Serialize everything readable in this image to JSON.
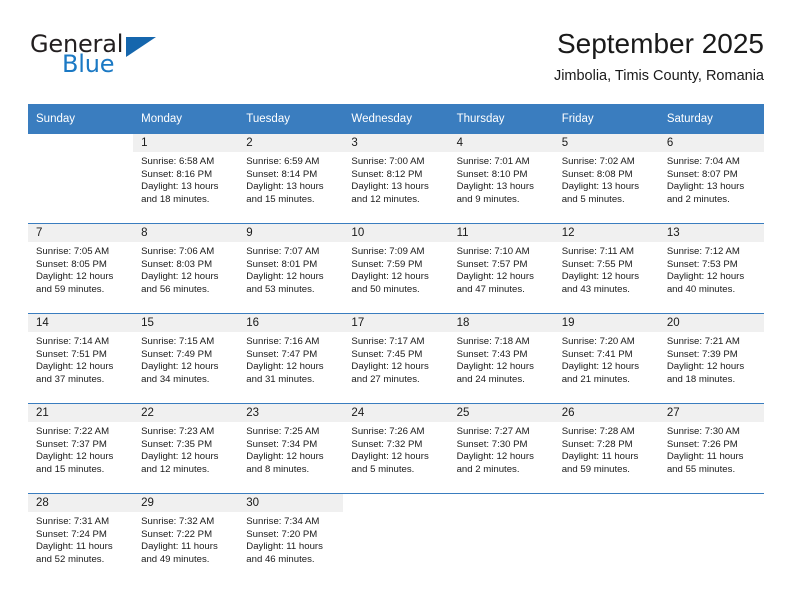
{
  "brand": {
    "name_part1": "General",
    "name_part2": "Blue",
    "accent_color": "#1b79c4",
    "triangle_color": "#1566ad",
    "logo_icon": "triangle-logo-icon"
  },
  "header": {
    "month_title": "September 2025",
    "location": "Jimbolia, Timis County, Romania"
  },
  "calendar": {
    "header_bg": "#3a7dbf",
    "daynum_band_bg": "#f0f0f0",
    "weekday_headers": [
      "Sunday",
      "Monday",
      "Tuesday",
      "Wednesday",
      "Thursday",
      "Friday",
      "Saturday"
    ],
    "weeks": [
      [
        {
          "day": "",
          "sunrise": "",
          "sunset": "",
          "daylight_line1": "",
          "daylight_line2": "",
          "blank": true
        },
        {
          "day": "1",
          "sunrise": "Sunrise: 6:58 AM",
          "sunset": "Sunset: 8:16 PM",
          "daylight_line1": "Daylight: 13 hours",
          "daylight_line2": "and 18 minutes."
        },
        {
          "day": "2",
          "sunrise": "Sunrise: 6:59 AM",
          "sunset": "Sunset: 8:14 PM",
          "daylight_line1": "Daylight: 13 hours",
          "daylight_line2": "and 15 minutes."
        },
        {
          "day": "3",
          "sunrise": "Sunrise: 7:00 AM",
          "sunset": "Sunset: 8:12 PM",
          "daylight_line1": "Daylight: 13 hours",
          "daylight_line2": "and 12 minutes."
        },
        {
          "day": "4",
          "sunrise": "Sunrise: 7:01 AM",
          "sunset": "Sunset: 8:10 PM",
          "daylight_line1": "Daylight: 13 hours",
          "daylight_line2": "and 9 minutes."
        },
        {
          "day": "5",
          "sunrise": "Sunrise: 7:02 AM",
          "sunset": "Sunset: 8:08 PM",
          "daylight_line1": "Daylight: 13 hours",
          "daylight_line2": "and 5 minutes."
        },
        {
          "day": "6",
          "sunrise": "Sunrise: 7:04 AM",
          "sunset": "Sunset: 8:07 PM",
          "daylight_line1": "Daylight: 13 hours",
          "daylight_line2": "and 2 minutes."
        }
      ],
      [
        {
          "day": "7",
          "sunrise": "Sunrise: 7:05 AM",
          "sunset": "Sunset: 8:05 PM",
          "daylight_line1": "Daylight: 12 hours",
          "daylight_line2": "and 59 minutes."
        },
        {
          "day": "8",
          "sunrise": "Sunrise: 7:06 AM",
          "sunset": "Sunset: 8:03 PM",
          "daylight_line1": "Daylight: 12 hours",
          "daylight_line2": "and 56 minutes."
        },
        {
          "day": "9",
          "sunrise": "Sunrise: 7:07 AM",
          "sunset": "Sunset: 8:01 PM",
          "daylight_line1": "Daylight: 12 hours",
          "daylight_line2": "and 53 minutes."
        },
        {
          "day": "10",
          "sunrise": "Sunrise: 7:09 AM",
          "sunset": "Sunset: 7:59 PM",
          "daylight_line1": "Daylight: 12 hours",
          "daylight_line2": "and 50 minutes."
        },
        {
          "day": "11",
          "sunrise": "Sunrise: 7:10 AM",
          "sunset": "Sunset: 7:57 PM",
          "daylight_line1": "Daylight: 12 hours",
          "daylight_line2": "and 47 minutes."
        },
        {
          "day": "12",
          "sunrise": "Sunrise: 7:11 AM",
          "sunset": "Sunset: 7:55 PM",
          "daylight_line1": "Daylight: 12 hours",
          "daylight_line2": "and 43 minutes."
        },
        {
          "day": "13",
          "sunrise": "Sunrise: 7:12 AM",
          "sunset": "Sunset: 7:53 PM",
          "daylight_line1": "Daylight: 12 hours",
          "daylight_line2": "and 40 minutes."
        }
      ],
      [
        {
          "day": "14",
          "sunrise": "Sunrise: 7:14 AM",
          "sunset": "Sunset: 7:51 PM",
          "daylight_line1": "Daylight: 12 hours",
          "daylight_line2": "and 37 minutes."
        },
        {
          "day": "15",
          "sunrise": "Sunrise: 7:15 AM",
          "sunset": "Sunset: 7:49 PM",
          "daylight_line1": "Daylight: 12 hours",
          "daylight_line2": "and 34 minutes."
        },
        {
          "day": "16",
          "sunrise": "Sunrise: 7:16 AM",
          "sunset": "Sunset: 7:47 PM",
          "daylight_line1": "Daylight: 12 hours",
          "daylight_line2": "and 31 minutes."
        },
        {
          "day": "17",
          "sunrise": "Sunrise: 7:17 AM",
          "sunset": "Sunset: 7:45 PM",
          "daylight_line1": "Daylight: 12 hours",
          "daylight_line2": "and 27 minutes."
        },
        {
          "day": "18",
          "sunrise": "Sunrise: 7:18 AM",
          "sunset": "Sunset: 7:43 PM",
          "daylight_line1": "Daylight: 12 hours",
          "daylight_line2": "and 24 minutes."
        },
        {
          "day": "19",
          "sunrise": "Sunrise: 7:20 AM",
          "sunset": "Sunset: 7:41 PM",
          "daylight_line1": "Daylight: 12 hours",
          "daylight_line2": "and 21 minutes."
        },
        {
          "day": "20",
          "sunrise": "Sunrise: 7:21 AM",
          "sunset": "Sunset: 7:39 PM",
          "daylight_line1": "Daylight: 12 hours",
          "daylight_line2": "and 18 minutes."
        }
      ],
      [
        {
          "day": "21",
          "sunrise": "Sunrise: 7:22 AM",
          "sunset": "Sunset: 7:37 PM",
          "daylight_line1": "Daylight: 12 hours",
          "daylight_line2": "and 15 minutes."
        },
        {
          "day": "22",
          "sunrise": "Sunrise: 7:23 AM",
          "sunset": "Sunset: 7:35 PM",
          "daylight_line1": "Daylight: 12 hours",
          "daylight_line2": "and 12 minutes."
        },
        {
          "day": "23",
          "sunrise": "Sunrise: 7:25 AM",
          "sunset": "Sunset: 7:34 PM",
          "daylight_line1": "Daylight: 12 hours",
          "daylight_line2": "and 8 minutes."
        },
        {
          "day": "24",
          "sunrise": "Sunrise: 7:26 AM",
          "sunset": "Sunset: 7:32 PM",
          "daylight_line1": "Daylight: 12 hours",
          "daylight_line2": "and 5 minutes."
        },
        {
          "day": "25",
          "sunrise": "Sunrise: 7:27 AM",
          "sunset": "Sunset: 7:30 PM",
          "daylight_line1": "Daylight: 12 hours",
          "daylight_line2": "and 2 minutes."
        },
        {
          "day": "26",
          "sunrise": "Sunrise: 7:28 AM",
          "sunset": "Sunset: 7:28 PM",
          "daylight_line1": "Daylight: 11 hours",
          "daylight_line2": "and 59 minutes."
        },
        {
          "day": "27",
          "sunrise": "Sunrise: 7:30 AM",
          "sunset": "Sunset: 7:26 PM",
          "daylight_line1": "Daylight: 11 hours",
          "daylight_line2": "and 55 minutes."
        }
      ],
      [
        {
          "day": "28",
          "sunrise": "Sunrise: 7:31 AM",
          "sunset": "Sunset: 7:24 PM",
          "daylight_line1": "Daylight: 11 hours",
          "daylight_line2": "and 52 minutes."
        },
        {
          "day": "29",
          "sunrise": "Sunrise: 7:32 AM",
          "sunset": "Sunset: 7:22 PM",
          "daylight_line1": "Daylight: 11 hours",
          "daylight_line2": "and 49 minutes."
        },
        {
          "day": "30",
          "sunrise": "Sunrise: 7:34 AM",
          "sunset": "Sunset: 7:20 PM",
          "daylight_line1": "Daylight: 11 hours",
          "daylight_line2": "and 46 minutes."
        },
        {
          "day": "",
          "sunrise": "",
          "sunset": "",
          "daylight_line1": "",
          "daylight_line2": "",
          "blank": true
        },
        {
          "day": "",
          "sunrise": "",
          "sunset": "",
          "daylight_line1": "",
          "daylight_line2": "",
          "blank": true
        },
        {
          "day": "",
          "sunrise": "",
          "sunset": "",
          "daylight_line1": "",
          "daylight_line2": "",
          "blank": true
        },
        {
          "day": "",
          "sunrise": "",
          "sunset": "",
          "daylight_line1": "",
          "daylight_line2": "",
          "blank": true
        }
      ]
    ]
  }
}
